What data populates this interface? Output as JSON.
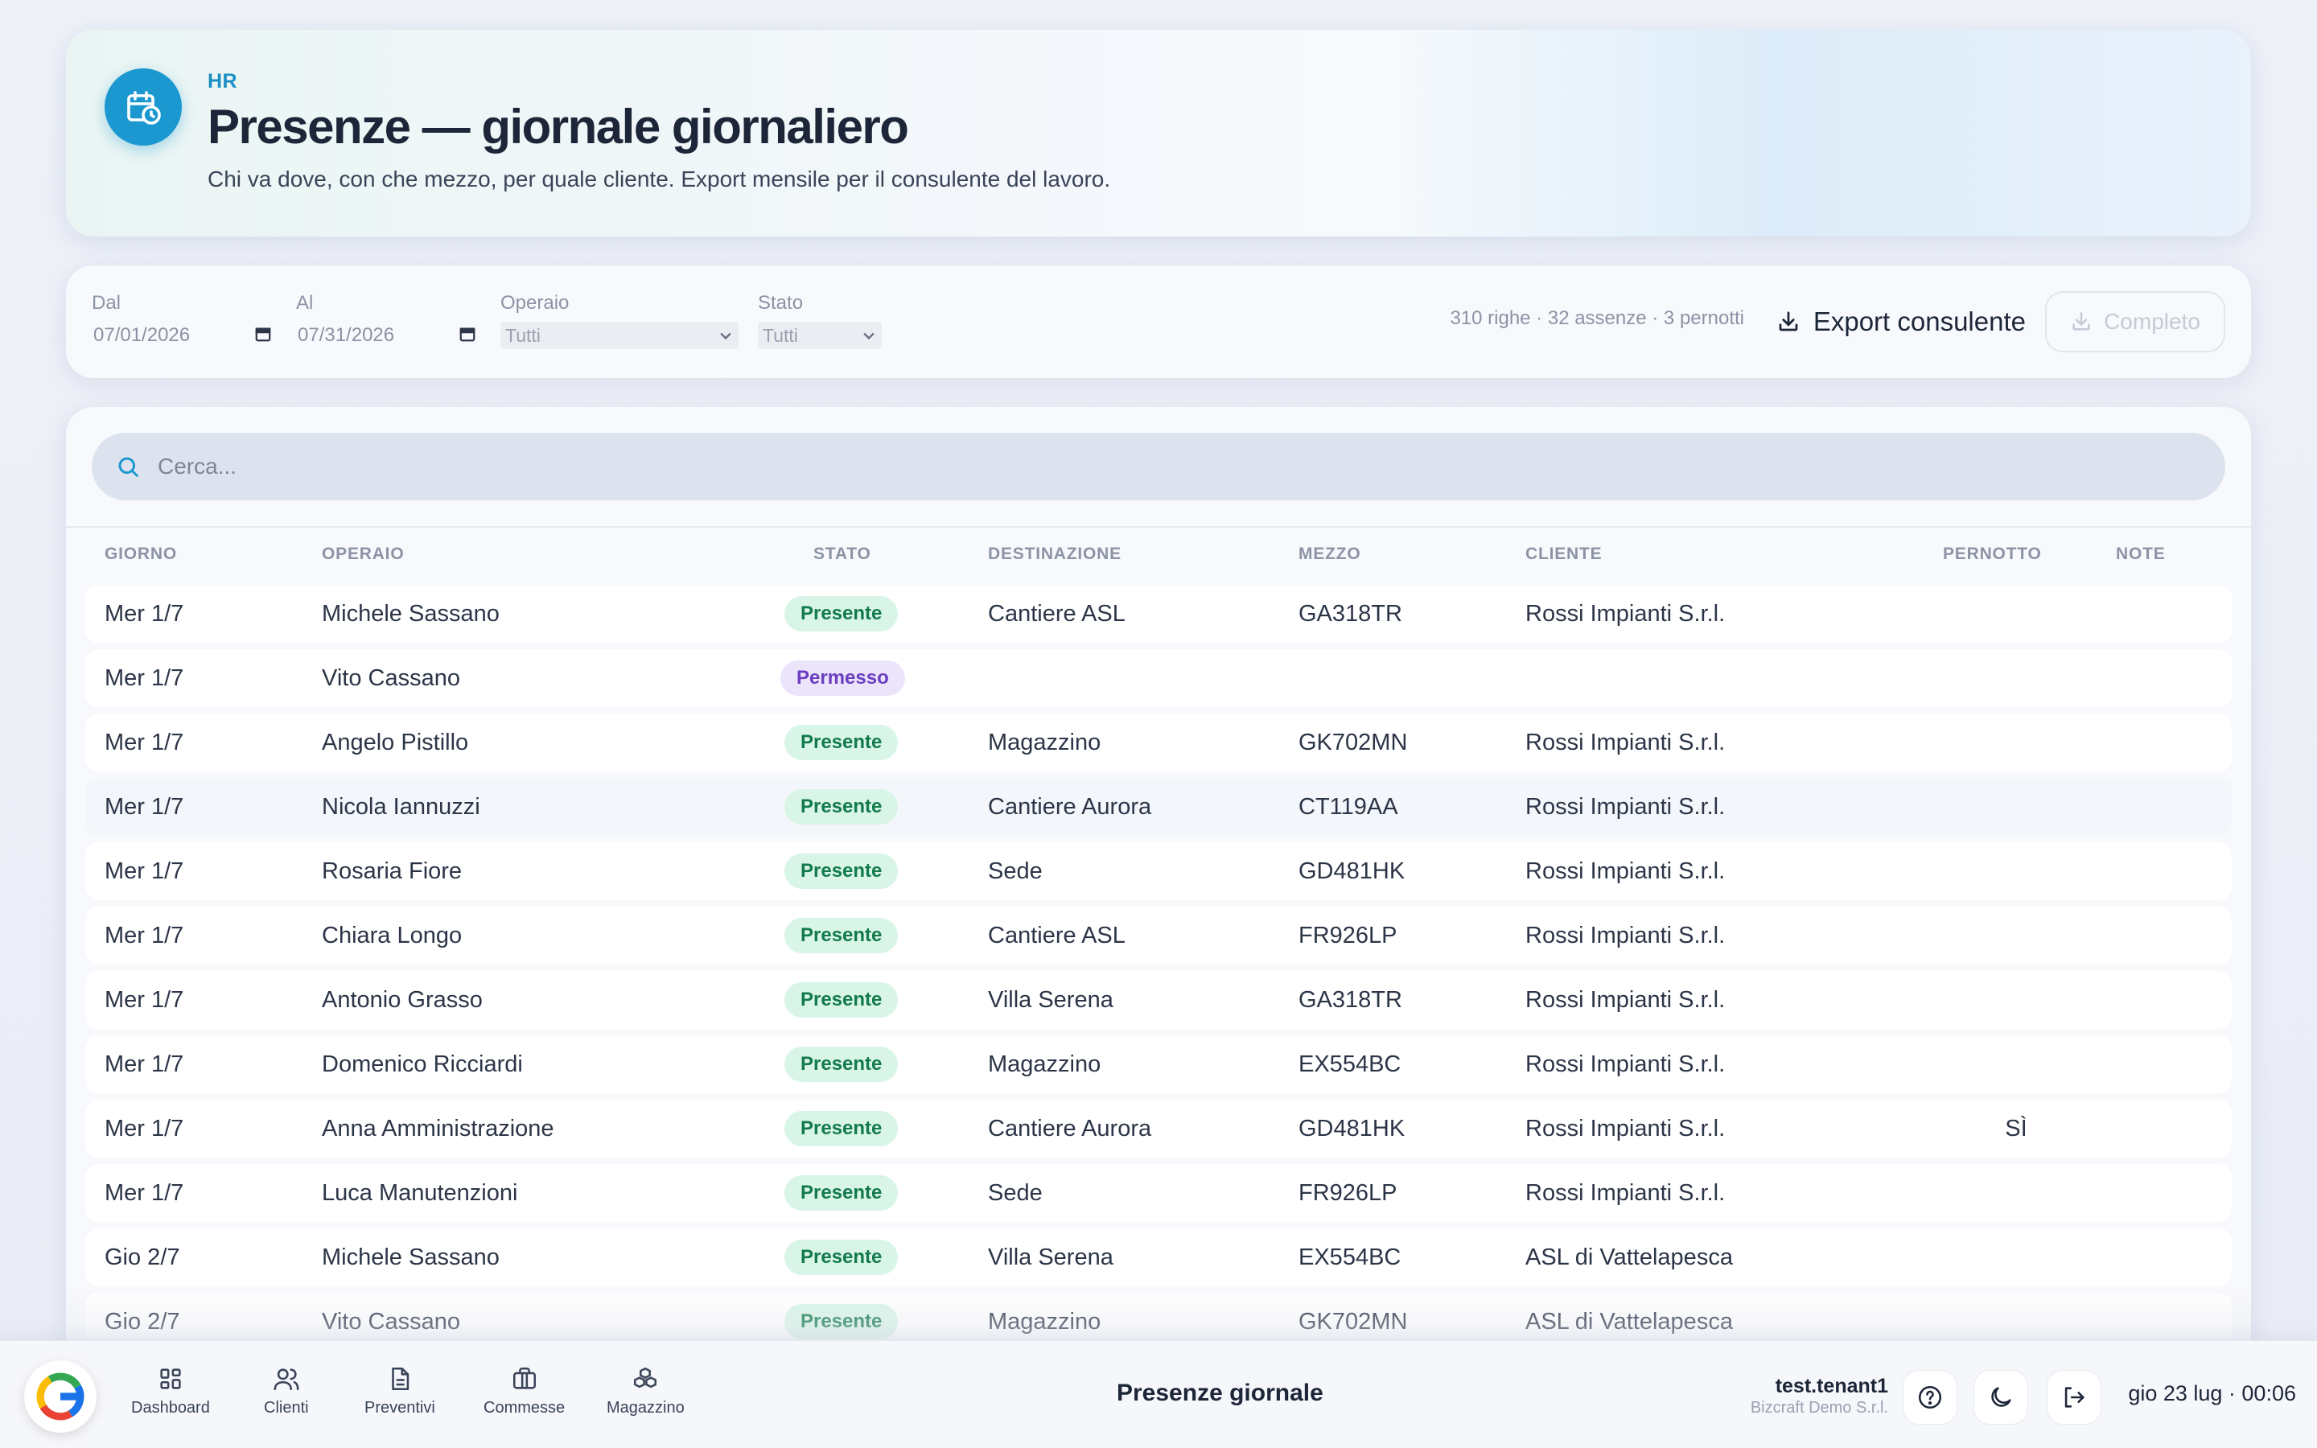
{
  "header": {
    "kicker": "HR",
    "title": "Presenze — giornale giornaliero",
    "subtitle": "Chi va dove, con che mezzo, per quale cliente. Export mensile per il consulente del lavoro.",
    "icon": "calendar-clock-icon"
  },
  "filters": {
    "dal_label": "Dal",
    "dal_value": "07/01/2026",
    "al_label": "Al",
    "al_value": "07/31/2026",
    "operaio_label": "Operaio",
    "operaio_value": "Tutti",
    "stato_label": "Stato",
    "stato_value": "Tutti",
    "stats": "310 righe · 32 assenze · 3 pernotti",
    "export_label": "Export consulente",
    "completo_label": "Completo"
  },
  "search": {
    "placeholder": "Cerca..."
  },
  "table": {
    "columns": {
      "giorno": "GIORNO",
      "operaio": "OPERAIO",
      "stato": "STATO",
      "destinazione": "DESTINAZIONE",
      "mezzo": "MEZZO",
      "cliente": "CLIENTE",
      "pernotto": "PERNOTTO",
      "note": "NOTE"
    },
    "rows": [
      {
        "giorno": "Mer 1/7",
        "operaio": "Michele Sassano",
        "stato": "Presente",
        "destinazione": "Cantiere ASL",
        "mezzo": "GA318TR",
        "cliente": "Rossi Impianti S.r.l.",
        "pernotto": "",
        "note": ""
      },
      {
        "giorno": "Mer 1/7",
        "operaio": "Vito Cassano",
        "stato": "Permesso",
        "destinazione": "",
        "mezzo": "",
        "cliente": "",
        "pernotto": "",
        "note": ""
      },
      {
        "giorno": "Mer 1/7",
        "operaio": "Angelo Pistillo",
        "stato": "Presente",
        "destinazione": "Magazzino",
        "mezzo": "GK702MN",
        "cliente": "Rossi Impianti S.r.l.",
        "pernotto": "",
        "note": ""
      },
      {
        "giorno": "Mer 1/7",
        "operaio": "Nicola Iannuzzi",
        "stato": "Presente",
        "destinazione": "Cantiere Aurora",
        "mezzo": "CT119AA",
        "cliente": "Rossi Impianti S.r.l.",
        "pernotto": "",
        "note": ""
      },
      {
        "giorno": "Mer 1/7",
        "operaio": "Rosaria Fiore",
        "stato": "Presente",
        "destinazione": "Sede",
        "mezzo": "GD481HK",
        "cliente": "Rossi Impianti S.r.l.",
        "pernotto": "",
        "note": ""
      },
      {
        "giorno": "Mer 1/7",
        "operaio": "Chiara Longo",
        "stato": "Presente",
        "destinazione": "Cantiere ASL",
        "mezzo": "FR926LP",
        "cliente": "Rossi Impianti S.r.l.",
        "pernotto": "",
        "note": ""
      },
      {
        "giorno": "Mer 1/7",
        "operaio": "Antonio Grasso",
        "stato": "Presente",
        "destinazione": "Villa Serena",
        "mezzo": "GA318TR",
        "cliente": "Rossi Impianti S.r.l.",
        "pernotto": "",
        "note": ""
      },
      {
        "giorno": "Mer 1/7",
        "operaio": "Domenico Ricciardi",
        "stato": "Presente",
        "destinazione": "Magazzino",
        "mezzo": "EX554BC",
        "cliente": "Rossi Impianti S.r.l.",
        "pernotto": "",
        "note": ""
      },
      {
        "giorno": "Mer 1/7",
        "operaio": "Anna Amministrazione",
        "stato": "Presente",
        "destinazione": "Cantiere Aurora",
        "mezzo": "GD481HK",
        "cliente": "Rossi Impianti S.r.l.",
        "pernotto": "SÌ",
        "note": ""
      },
      {
        "giorno": "Mer 1/7",
        "operaio": "Luca Manutenzioni",
        "stato": "Presente",
        "destinazione": "Sede",
        "mezzo": "FR926LP",
        "cliente": "Rossi Impianti S.r.l.",
        "pernotto": "",
        "note": ""
      },
      {
        "giorno": "Gio 2/7",
        "operaio": "Michele Sassano",
        "stato": "Presente",
        "destinazione": "Villa Serena",
        "mezzo": "EX554BC",
        "cliente": "ASL di Vattelapesca",
        "pernotto": "",
        "note": ""
      },
      {
        "giorno": "Gio 2/7",
        "operaio": "Vito Cassano",
        "stato": "Presente",
        "destinazione": "Magazzino",
        "mezzo": "GK702MN",
        "cliente": "ASL di Vattelapesca",
        "pernotto": "",
        "note": ""
      }
    ]
  },
  "bottom_bar": {
    "nav": [
      {
        "label": "Dashboard",
        "icon": "grid-icon"
      },
      {
        "label": "Clienti",
        "icon": "users-icon"
      },
      {
        "label": "Preventivi",
        "icon": "document-icon"
      },
      {
        "label": "Commesse",
        "icon": "briefcase-icon"
      },
      {
        "label": "Magazzino",
        "icon": "boxes-icon"
      }
    ],
    "title": "Presenze giornale",
    "user": "test.tenant1",
    "org": "Bizcraft Demo S.r.l.",
    "datetime": "gio 23 lug · 00:06"
  },
  "colors": {
    "accent": "#1a98cf",
    "presente_bg": "#d8f5e7",
    "presente_text": "#137a4c",
    "permesso_bg": "#ece4fb",
    "permesso_text": "#6b3fc0"
  }
}
